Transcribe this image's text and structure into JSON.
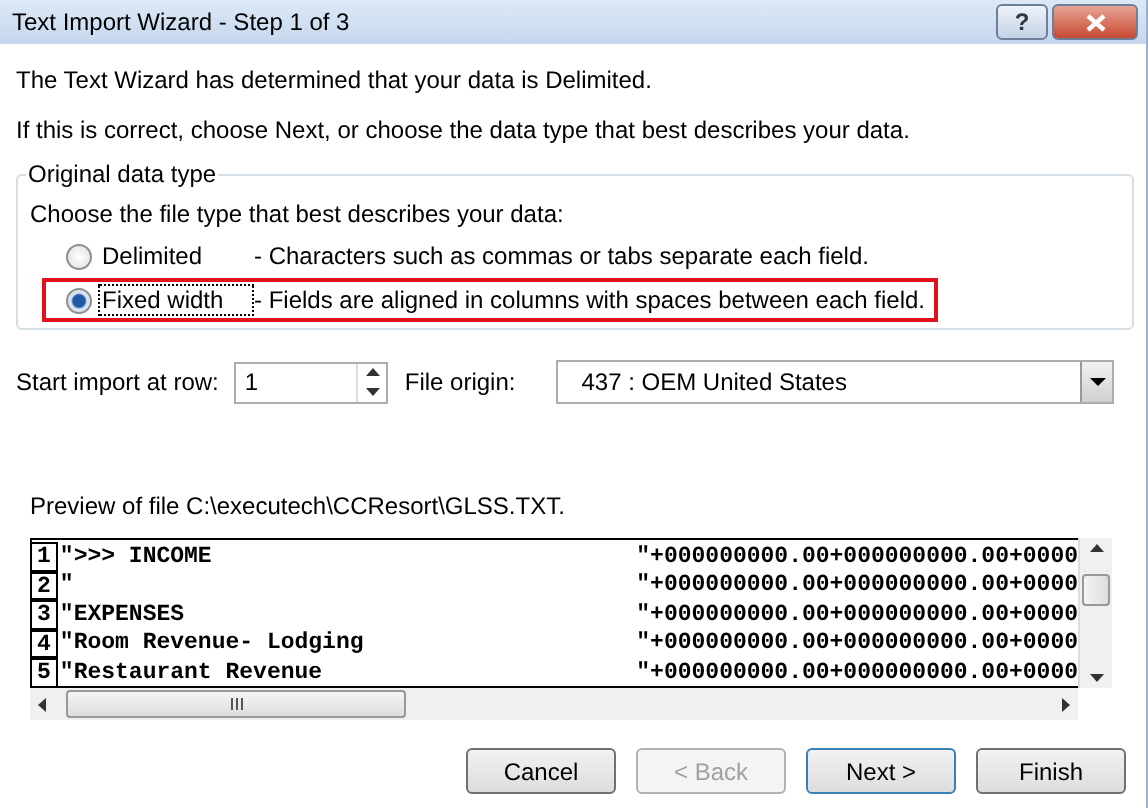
{
  "window": {
    "title": "Text Import Wizard - Step 1 of 3",
    "help_button": "?"
  },
  "intro": [
    "The Text Wizard has determined that your data is Delimited.",
    "If this is correct, choose Next, or choose the data type that best describes your data."
  ],
  "group": {
    "title": "Original data type",
    "prompt": "Choose the file type that best describes your data:",
    "options": [
      {
        "label": "Delimited",
        "description": "- Characters such as commas or tabs separate each field.",
        "selected": false,
        "highlighted": false
      },
      {
        "label": "Fixed width",
        "description": "- Fields are aligned in columns with spaces between each field.",
        "selected": true,
        "highlighted": true
      }
    ]
  },
  "start_row": {
    "label": "Start import at row:",
    "value": "1"
  },
  "file_origin": {
    "label": "File origin:",
    "value": "437 : OEM United States"
  },
  "preview": {
    "label": "Preview of file C:\\executech\\CCResort\\GLSS.TXT.",
    "rows": [
      {
        "number": "1",
        "text": "\">>> INCOME",
        "values": "\"+000000000.00+000000000.00+0000"
      },
      {
        "number": "2",
        "text": "\"",
        "values": "\"+000000000.00+000000000.00+0000"
      },
      {
        "number": "3",
        "text": "\"EXPENSES",
        "values": "\"+000000000.00+000000000.00+0000"
      },
      {
        "number": "4",
        "text": "\"Room Revenue- Lodging",
        "values": "\"+000000000.00+000000000.00+0000"
      },
      {
        "number": "5",
        "text": "\"Restaurant Revenue",
        "values": "\"+000000000.00+000000000.00+0000"
      }
    ]
  },
  "buttons": [
    {
      "label": "Cancel",
      "disabled": false,
      "default": false
    },
    {
      "label": "< Back",
      "disabled": true,
      "default": false
    },
    {
      "label": "Next >",
      "disabled": false,
      "default": true
    },
    {
      "label": "Finish",
      "disabled": false,
      "default": false
    }
  ]
}
